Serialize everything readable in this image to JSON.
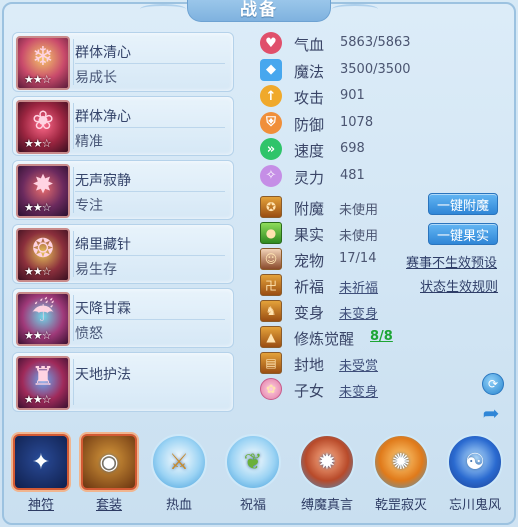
{
  "title": "战备",
  "skills": [
    {
      "name": "群体清心",
      "sub": "易成长",
      "stars": "★★☆",
      "icon": "cleanse-icon"
    },
    {
      "name": "群体净心",
      "sub": "精准",
      "stars": "★★☆",
      "icon": "purify-icon"
    },
    {
      "name": "无声寂静",
      "sub": "专注",
      "stars": "★★☆",
      "icon": "silence-icon"
    },
    {
      "name": "绵里藏针",
      "sub": "易生存",
      "stars": "★★☆",
      "icon": "needle-icon"
    },
    {
      "name": "天降甘霖",
      "sub": "愤怒",
      "stars": "★★☆",
      "icon": "rain-icon"
    },
    {
      "name": "天地护法",
      "sub": "",
      "stars": "★★☆",
      "icon": "guardian-icon"
    }
  ],
  "attributes": [
    {
      "label": "气血",
      "value": "5863/5863",
      "icon": "heart-icon",
      "color": "#e0506b"
    },
    {
      "label": "魔法",
      "value": "3500/3500",
      "icon": "mana-icon",
      "color": "#47a7ee"
    },
    {
      "label": "攻击",
      "value": "901",
      "icon": "attack-icon",
      "color": "#f0a92b"
    },
    {
      "label": "防御",
      "value": "1078",
      "icon": "shield-icon",
      "color": "#f08f3a"
    },
    {
      "label": "速度",
      "value": "698",
      "icon": "speed-icon",
      "color": "#2fc46a"
    },
    {
      "label": "灵力",
      "value": "481",
      "icon": "spirit-icon",
      "color": "#c58ee6"
    }
  ],
  "buffs": [
    {
      "label": "附魔",
      "value": "未使用",
      "style": "plain"
    },
    {
      "label": "果实",
      "value": "未使用",
      "style": "plain"
    },
    {
      "label": "宠物",
      "value": "17/14",
      "style": "plain"
    },
    {
      "label": "祈福",
      "value": "未祈福",
      "style": "link"
    },
    {
      "label": "变身",
      "value": "未变身",
      "style": "link"
    },
    {
      "label": "修炼觉醒",
      "value": "8/8",
      "style": "green"
    },
    {
      "label": "封地",
      "value": "未受赏",
      "style": "link"
    },
    {
      "label": "子女",
      "value": "未变身",
      "style": "link"
    }
  ],
  "actions": {
    "enchant_btn": "一键附魔",
    "fruit_btn": "一键果实",
    "event_preset": "赛事不生效预设",
    "status_rule": "状态生效规则"
  },
  "bottom": [
    {
      "label": "神符",
      "shape": "square",
      "underline": true,
      "icon": "rune-icon",
      "glyph": "✦"
    },
    {
      "label": "套装",
      "shape": "square",
      "underline": true,
      "icon": "suit-icon",
      "glyph": "◉"
    },
    {
      "label": "热血",
      "shape": "circle",
      "underline": false,
      "icon": "passion-icon",
      "glyph": "⚔"
    },
    {
      "label": "祝福",
      "shape": "circle",
      "underline": false,
      "icon": "blessing-icon",
      "glyph": "❦"
    },
    {
      "label": "缚魔真言",
      "shape": "circle",
      "underline": false,
      "icon": "bind-demon-icon",
      "glyph": "✹"
    },
    {
      "label": "乾罡寂灭",
      "shape": "circle",
      "underline": false,
      "icon": "qiangang-icon",
      "glyph": "✺"
    },
    {
      "label": "忘川鬼风",
      "shape": "circle",
      "underline": false,
      "icon": "ghost-wind-icon",
      "glyph": "☯"
    }
  ]
}
